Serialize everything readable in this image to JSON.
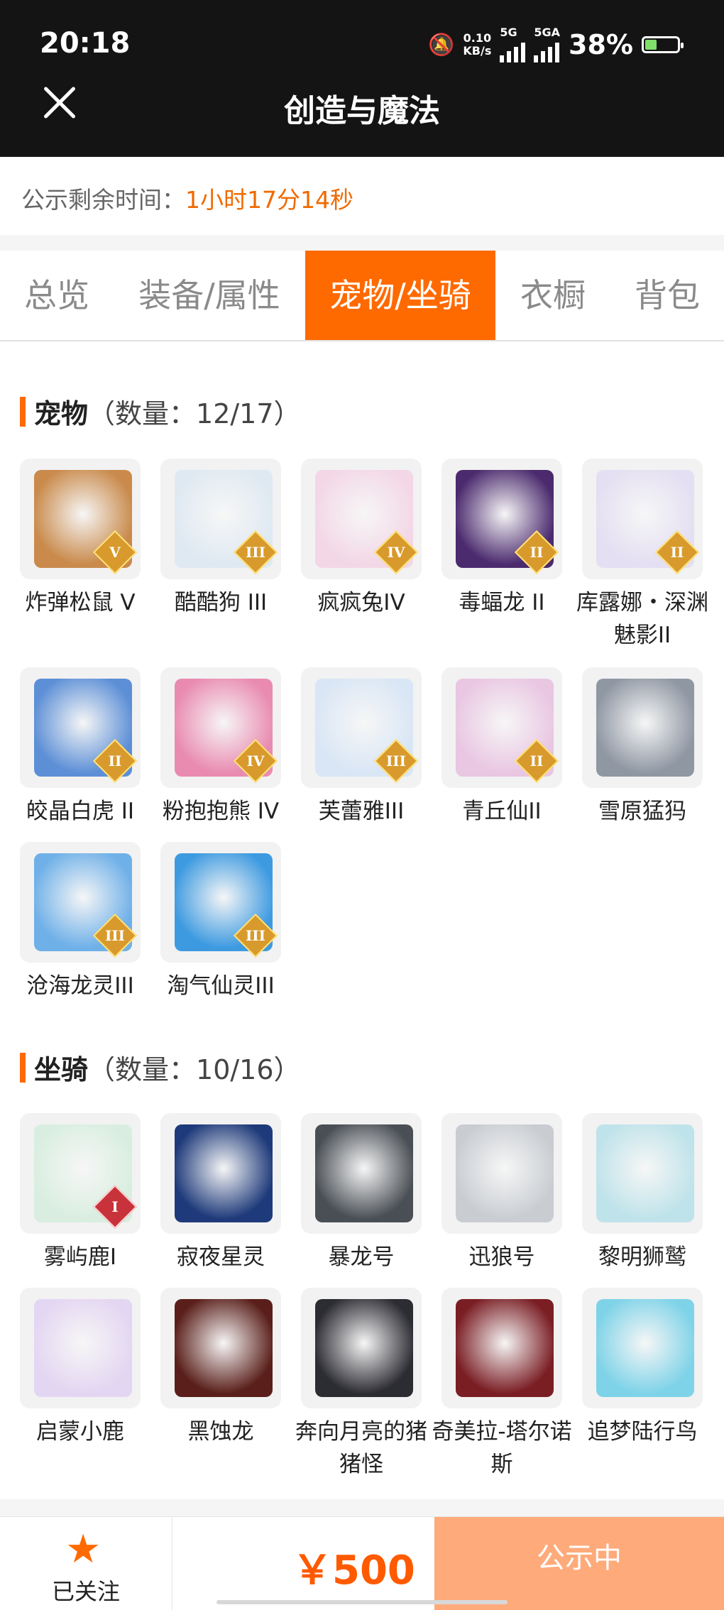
{
  "status_bar": {
    "time": "20:18",
    "speed_value": "0.10",
    "speed_unit": "KB/s",
    "net1": "5G",
    "net2": "5GA",
    "battery_pct": "38%",
    "battery_level": 0.38
  },
  "header": {
    "close_icon": "close-icon",
    "title": "创造与魔法"
  },
  "countdown": {
    "label": "公示剩余时间：",
    "value": "1小时17分14秒"
  },
  "tabs": [
    {
      "label": "总览"
    },
    {
      "label": "装备/属性"
    },
    {
      "label": "宠物/坐骑",
      "active": true
    },
    {
      "label": "衣橱"
    },
    {
      "label": "背包"
    }
  ],
  "pets": {
    "title": "宠物",
    "count": "（数量：12/17）",
    "items": [
      {
        "name": "炸弹松鼠 V",
        "badge": "V",
        "color": "#c98a4b"
      },
      {
        "name": "酷酷狗 III",
        "badge": "III",
        "color": "#dfe9f2"
      },
      {
        "name": "疯疯兔IV",
        "badge": "IV",
        "color": "#f3d7e6"
      },
      {
        "name": "毒蝠龙 II",
        "badge": "II",
        "color": "#4b2a6e"
      },
      {
        "name": "库露娜・深渊魅影II",
        "badge": "II",
        "color": "#e4dff2"
      },
      {
        "name": "皎晶白虎 II",
        "badge": "II",
        "color": "#5c8fd6"
      },
      {
        "name": "粉抱抱熊 IV",
        "badge": "IV",
        "color": "#e98bb0"
      },
      {
        "name": "芙蕾雅III",
        "badge": "III",
        "color": "#d9e6f5"
      },
      {
        "name": "青丘仙II",
        "badge": "II",
        "color": "#e9c6e2"
      },
      {
        "name": "雪原猛犸",
        "badge": "",
        "color": "#8f97a3"
      },
      {
        "name": "沧海龙灵III",
        "badge": "III",
        "color": "#6fb0e8"
      },
      {
        "name": "淘气仙灵III",
        "badge": "III",
        "color": "#3d9ae0"
      }
    ]
  },
  "mounts": {
    "title": "坐骑",
    "count": "（数量：10/16）",
    "items": [
      {
        "name": "雾屿鹿I",
        "badge": "I",
        "color": "#d9eee0",
        "red": true
      },
      {
        "name": "寂夜星灵",
        "badge": "",
        "color": "#1e3a7a"
      },
      {
        "name": "暴龙号",
        "badge": "",
        "color": "#4a4f55"
      },
      {
        "name": "迅狼号",
        "badge": "",
        "color": "#c9cdd2"
      },
      {
        "name": "黎明狮鹫",
        "badge": "",
        "color": "#bfe3ea"
      },
      {
        "name": "启蒙小鹿",
        "badge": "",
        "color": "#e3d6f2"
      },
      {
        "name": "黑蚀龙",
        "badge": "",
        "color": "#5a1f1a"
      },
      {
        "name": "奔向月亮的猪猪怪",
        "badge": "",
        "color": "#2c2c33"
      },
      {
        "name": "奇美拉-塔尔诺斯",
        "badge": "",
        "color": "#7a1e24"
      },
      {
        "name": "追梦陆行鸟",
        "badge": "",
        "color": "#7fd3e8"
      }
    ]
  },
  "bottom_bar": {
    "follow_label": "已关注",
    "follow_icon": "star-icon",
    "price": "￥500",
    "status_button": "公示中"
  }
}
